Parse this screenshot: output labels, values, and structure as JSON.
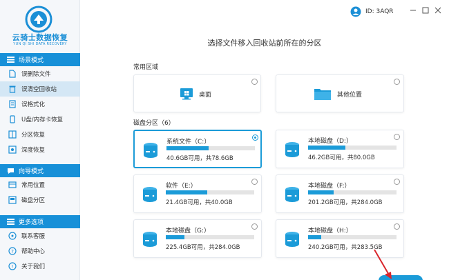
{
  "app": {
    "logo_title": "云骑士数据恢复",
    "logo_subtitle": "YUN QI SHI DATA RECOVERY",
    "user_id": "ID: 3AQR"
  },
  "sidebar": {
    "sections": [
      {
        "title": "场景模式",
        "items": [
          {
            "label": "误删除文件",
            "icon": "delete-file-icon"
          },
          {
            "label": "误清空回收站",
            "icon": "recycle-bin-icon",
            "active": true
          },
          {
            "label": "误格式化",
            "icon": "format-icon"
          },
          {
            "label": "U盘/内存卡恢复",
            "icon": "usb-icon"
          },
          {
            "label": "分区恢复",
            "icon": "partition-icon"
          },
          {
            "label": "深度恢复",
            "icon": "deep-scan-icon"
          }
        ]
      },
      {
        "title": "向导模式",
        "items": [
          {
            "label": "常用位置",
            "icon": "location-icon"
          },
          {
            "label": "磁盘分区",
            "icon": "disk-partition-icon"
          }
        ]
      },
      {
        "title": "更多选项",
        "items": [
          {
            "label": "联系客服",
            "icon": "headset-icon"
          },
          {
            "label": "帮助中心",
            "icon": "help-icon"
          },
          {
            "label": "关于我们",
            "icon": "info-icon"
          }
        ]
      }
    ]
  },
  "main": {
    "title": "选择文件移入回收站前所在的分区",
    "common_label": "常用区域",
    "common_areas": [
      {
        "label": "桌面",
        "icon": "desktop-icon"
      },
      {
        "label": "其他位置",
        "icon": "folder-icon"
      }
    ],
    "disk_label": "磁盘分区（6）",
    "drives": [
      {
        "name": "系统文件（C:）",
        "info": "40.6GB可用，共78.6GB",
        "used_fraction": 0.48,
        "selected": true
      },
      {
        "name": "本地磁盘（D:）",
        "info": "46.2GB可用，共80.0GB",
        "used_fraction": 0.42,
        "selected": false
      },
      {
        "name": "软件（E:）",
        "info": "21.4GB可用，共40.0GB",
        "used_fraction": 0.47,
        "selected": false
      },
      {
        "name": "本地磁盘（F:）",
        "info": "201.2GB可用，共284.0GB",
        "used_fraction": 0.29,
        "selected": false
      },
      {
        "name": "本地磁盘（G:）",
        "info": "225.4GB可用，共284.0GB",
        "used_fraction": 0.21,
        "selected": false
      },
      {
        "name": "本地磁盘（H:）",
        "info": "240.2GB可用，共283.5GB",
        "used_fraction": 0.15,
        "selected": false
      }
    ]
  },
  "colors": {
    "accent": "#1b9bd8",
    "sidebar_header": "#1790d8",
    "arrow": "#d9262c"
  }
}
